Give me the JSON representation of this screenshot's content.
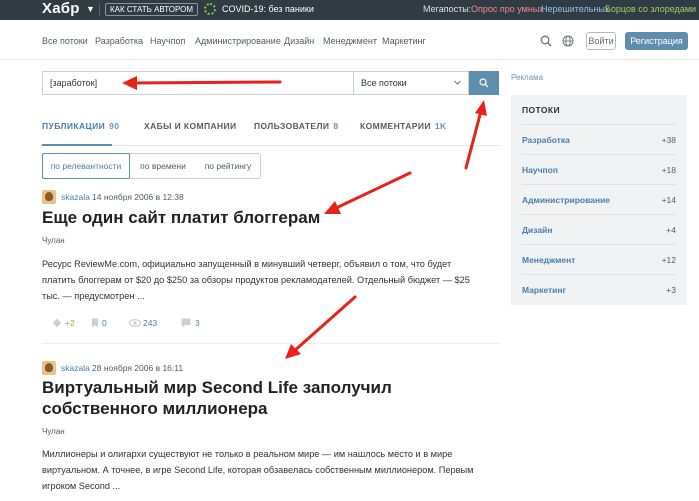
{
  "topbar": {
    "logo": "Хабр",
    "author_button": "Как стать автором",
    "covid": "COVID-19: без паники",
    "megaposts_label": "Мегапосты:",
    "megaposts": [
      "Опрос про умных",
      "Нерешительных",
      "Борцов со злоредами"
    ],
    "colors": {
      "bg": "#303b44",
      "mega1": "#f08b8b",
      "mega2": "#8fc6f3",
      "mega3": "#9bd267"
    }
  },
  "nav": {
    "items": [
      "Все потоки",
      "Разработка",
      "Научпоп",
      "Администрирование",
      "Дизайн",
      "Менеджмент",
      "Маркетинг"
    ],
    "login": "Войти",
    "register": "Регистрация"
  },
  "search": {
    "query": "[заработок]",
    "scope": "Все потоки",
    "ad": "Реклама"
  },
  "tabs": [
    {
      "label": "Публикации",
      "count": "90"
    },
    {
      "label": "Хабы и компании",
      "count": ""
    },
    {
      "label": "Пользователи",
      "count": "8"
    },
    {
      "label": "Комментарии",
      "count": "1k"
    }
  ],
  "sort": [
    "по релевантности",
    "по времени",
    "по рейтингу"
  ],
  "posts": [
    {
      "author": "skazala",
      "date": "14 ноября 2006 в 12:38",
      "title": "Еще один сайт платит блоггерам",
      "hub": "Чулан",
      "text": "Ресурс ReviewMe.com, официально запущенный в минувший четверг, объявил о том, что будет платить блоггерам от $20 до $250 за обзоры продуктов рекламодателей. Отдельный бюджет — $25 тыс. — предусмотрен ...",
      "votes": "+2",
      "bookmarks": "0",
      "views": "243",
      "comments": "3"
    },
    {
      "author": "skazala",
      "date": "28 ноября 2006 в 16:11",
      "title": "Виртуальный мир Second Life заполучил собственного миллионера",
      "hub": "Чулан",
      "text": "Миллионеры и олигархи существуют не только в реальном мире — им нашлось место и в мире виртуальном. А точнее, в игре Second Life, которая обзавелась собственным миллионером. Первым игроком Second ..."
    }
  ],
  "sidebar": {
    "title": "Потоки",
    "items": [
      {
        "name": "Разработка",
        "count": "+38"
      },
      {
        "name": "Научпоп",
        "count": "+18"
      },
      {
        "name": "Администрирование",
        "count": "+14"
      },
      {
        "name": "Дизайн",
        "count": "+4"
      },
      {
        "name": "Менеджмент",
        "count": "+12"
      },
      {
        "name": "Маркетинг",
        "count": "+3"
      }
    ]
  },
  "colors": {
    "accent": "#5e8eac",
    "link": "#4d7da8",
    "arrow": "#e8211a",
    "positive": "#7fb93a"
  }
}
